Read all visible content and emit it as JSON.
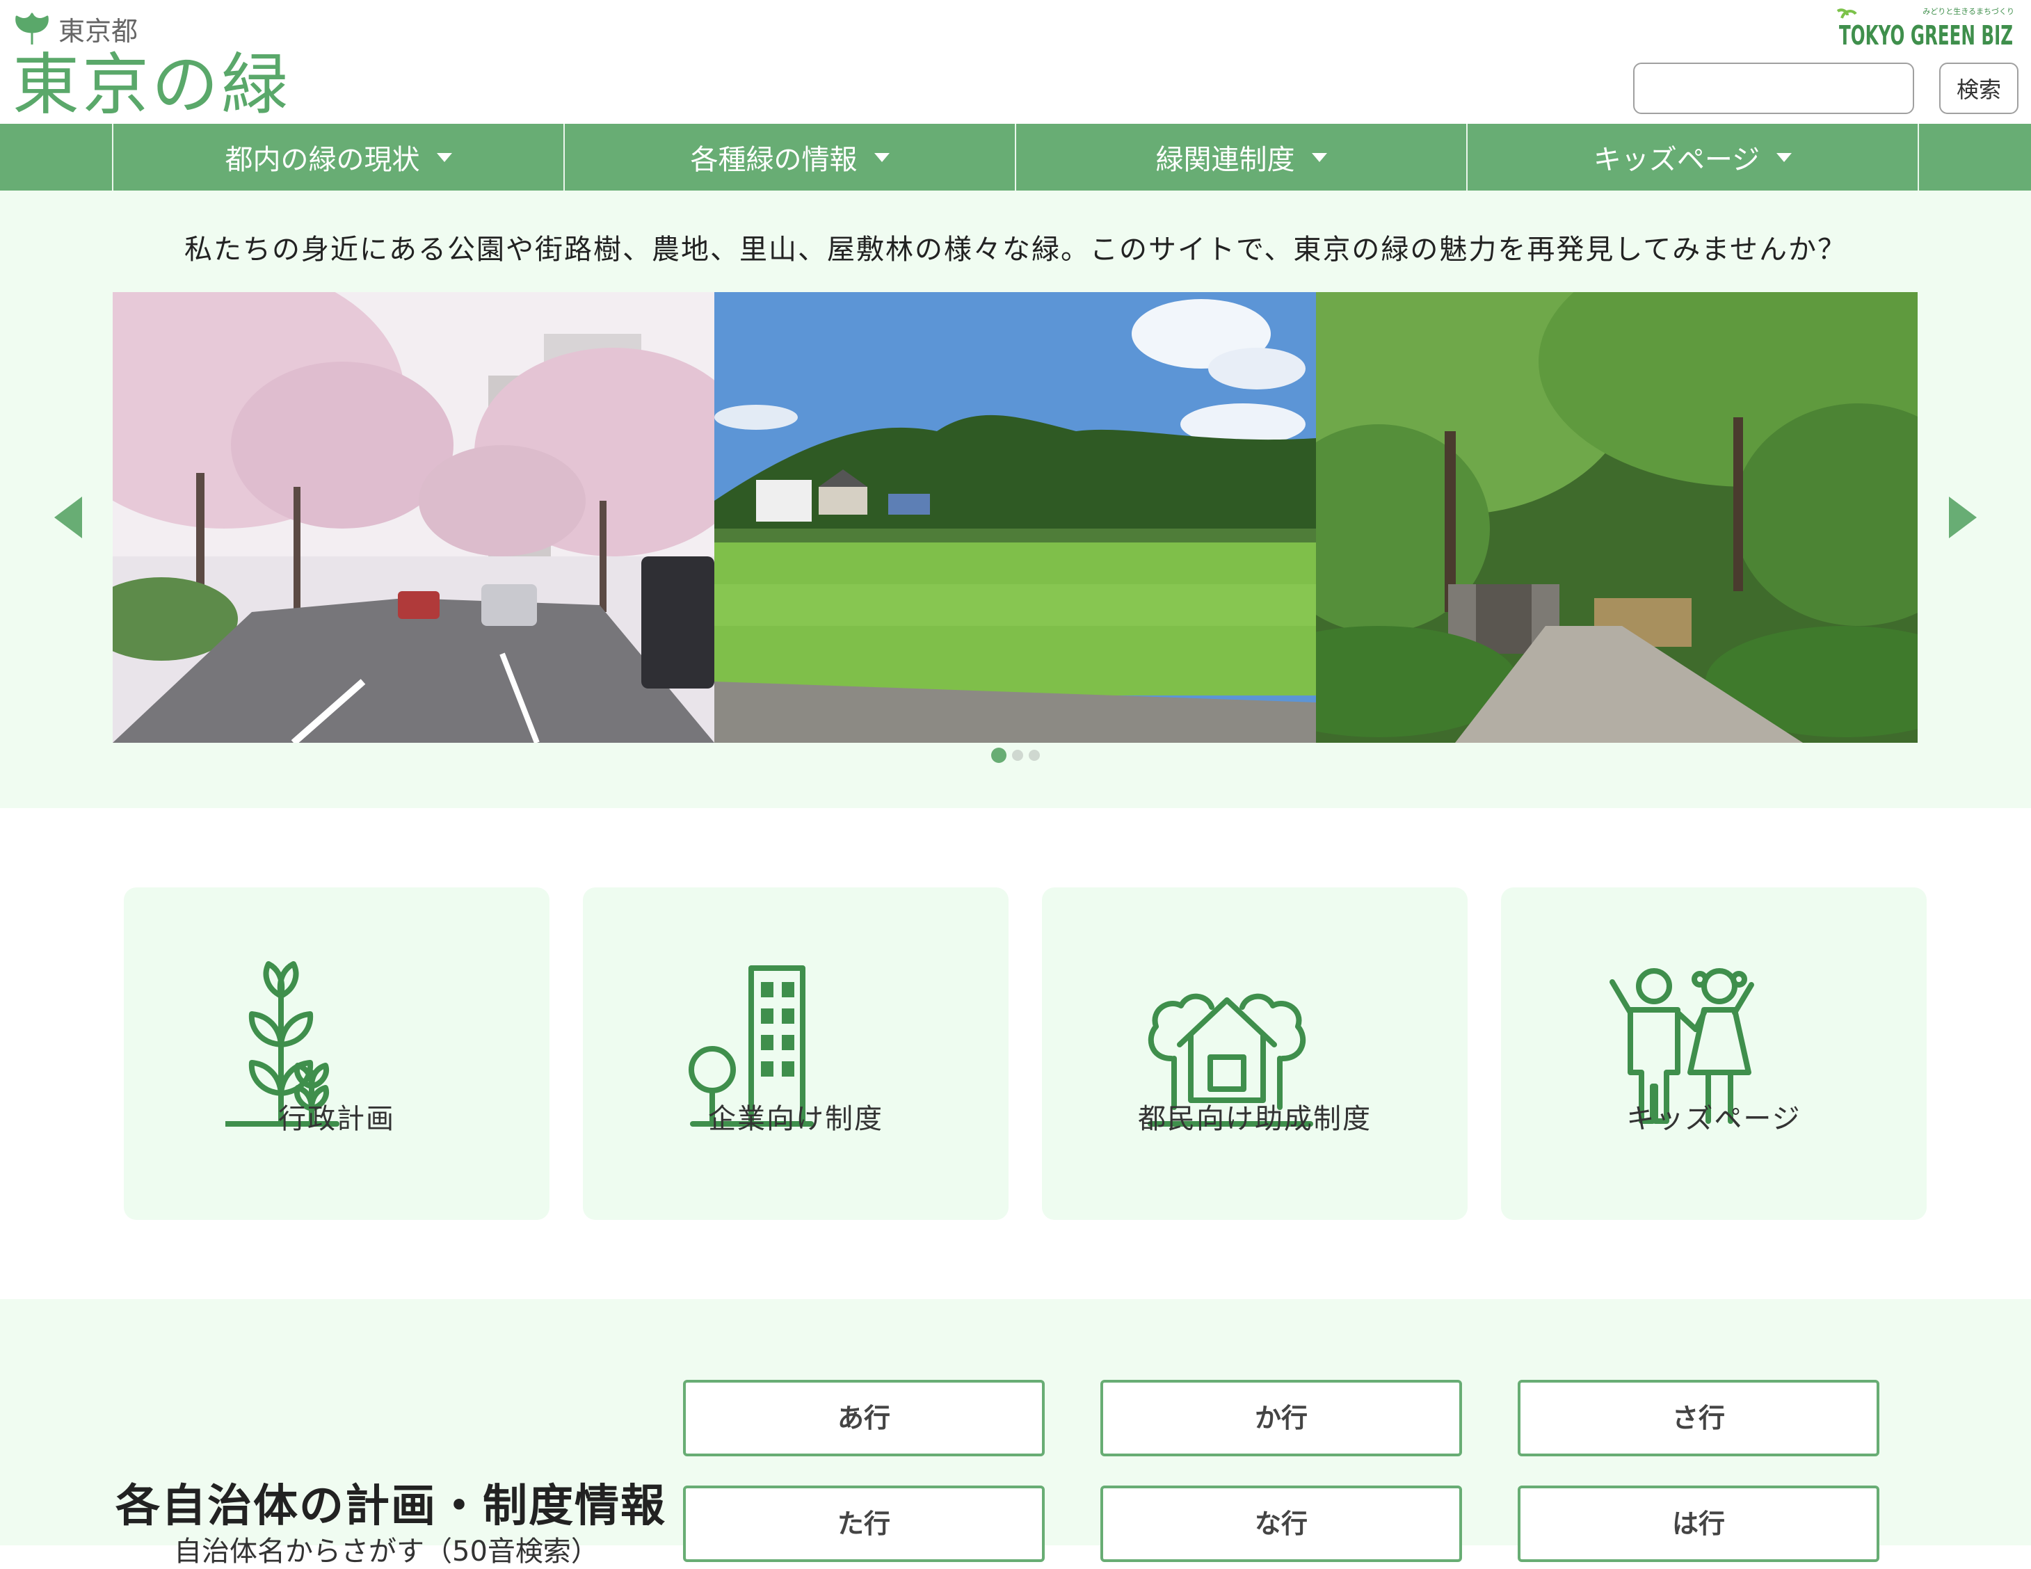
{
  "header": {
    "gov_label": "東京都",
    "site_title": "東京の緑",
    "biz_logo_text": "TOKYO GREEN BIZ",
    "biz_logo_tagline": "みどりと生きるまちづくり",
    "search_placeholder": "",
    "search_button_label": "検索"
  },
  "nav": {
    "items": [
      {
        "label": "都内の緑の現状"
      },
      {
        "label": "各種緑の情報"
      },
      {
        "label": "緑関連制度"
      },
      {
        "label": "キッズページ"
      }
    ]
  },
  "hero": {
    "intro": "私たちの身近にある公園や街路樹、農地、里山、屋敷林の様々な緑。このサイトで、東京の緑の魅力を再発見してみませんか？",
    "slides": [
      {
        "subject": "cherry-blossom-street"
      },
      {
        "subject": "rice-field-satoyama"
      },
      {
        "subject": "forest-path"
      }
    ],
    "slide_count": 3,
    "active_slide": 1
  },
  "categories": [
    {
      "label": "行政計画",
      "icon": "sprout-icon"
    },
    {
      "label": "企業向け制度",
      "icon": "building-tree-icon"
    },
    {
      "label": "都民向け助成制度",
      "icon": "house-trees-icon"
    },
    {
      "label": "キッズページ",
      "icon": "kids-icon"
    }
  ],
  "municipalities": {
    "title": "各自治体の計画・制度情報",
    "subtitle": "自治体名からさがす（50音検索）",
    "rows": [
      "あ行",
      "か行",
      "さ行",
      "た行",
      "な行",
      "は行"
    ]
  },
  "colors": {
    "brand_green": "#68ad74",
    "title_green": "#5aa86a",
    "hero_bg": "#f0fcf1",
    "card_bg": "#eefcf0",
    "icon_green": "#3f8f4c"
  }
}
